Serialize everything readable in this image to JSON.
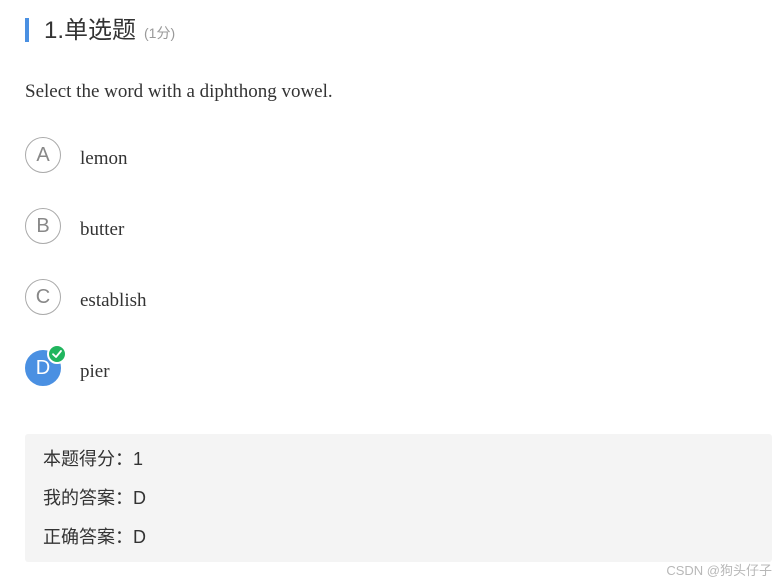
{
  "question_header": {
    "title": "1.单选题",
    "score_hint": "(1分)"
  },
  "question": {
    "text": "Select the word with a diphthong vowel."
  },
  "options": [
    {
      "letter": "A",
      "text": "lemon",
      "selected": false
    },
    {
      "letter": "B",
      "text": "butter",
      "selected": false
    },
    {
      "letter": "C",
      "text": "establish",
      "selected": false
    },
    {
      "letter": "D",
      "text": "pier",
      "selected": true
    }
  ],
  "result": {
    "score_line": "本题得分：1",
    "my_answer_line": "我的答案：D",
    "correct_answer_line": "正确答案：D"
  },
  "watermark": "CSDN @狗头仔子",
  "colors": {
    "accent": "#4a90e2",
    "correct": "#21b55e",
    "result_bg": "#f4f4f4"
  },
  "icons": {
    "correct_badge": "check-icon"
  }
}
